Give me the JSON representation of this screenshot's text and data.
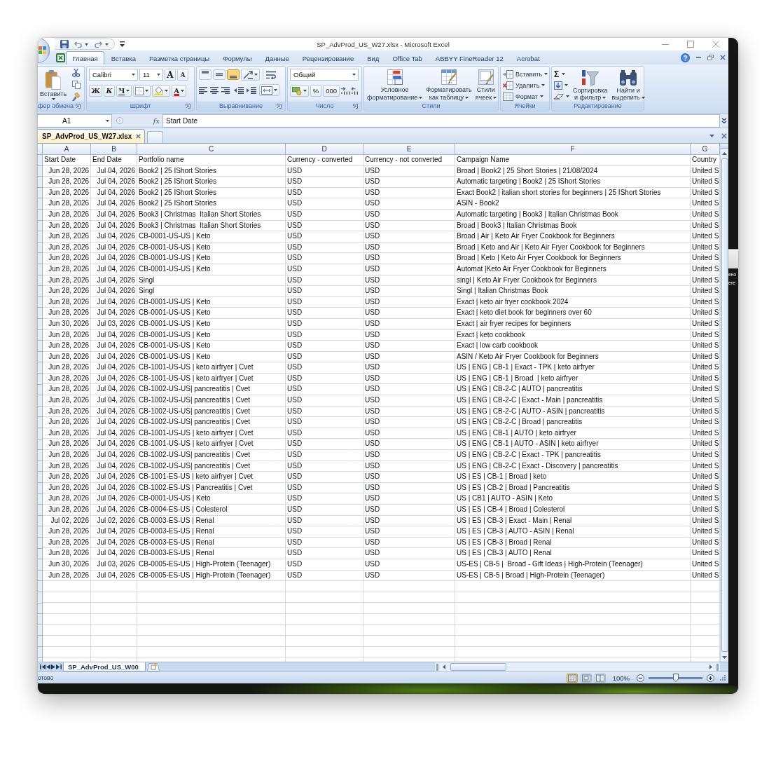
{
  "window": {
    "title": "SP_AdvProd_US_W27.xlsx - Microsoft Excel"
  },
  "ribbon_tabs": [
    {
      "label": "Главная",
      "selected": true
    },
    {
      "label": "Вставка",
      "selected": false
    },
    {
      "label": "Разметка страницы",
      "selected": false
    },
    {
      "label": "Формулы",
      "selected": false
    },
    {
      "label": "Данные",
      "selected": false
    },
    {
      "label": "Рецензирование",
      "selected": false
    },
    {
      "label": "Вид",
      "selected": false
    },
    {
      "label": "Office Tab",
      "selected": false
    },
    {
      "label": "ABBYY FineReader 12",
      "selected": false
    },
    {
      "label": "Acrobat",
      "selected": false
    }
  ],
  "ribbon_groups": [
    {
      "kind": "clipboard",
      "label": "фер обмена",
      "paste": "Вставить"
    },
    {
      "kind": "font",
      "label": "Шрифт",
      "font_name": "Calibri",
      "font_size": "11",
      "grow": "A",
      "shrink": "A",
      "styles": [
        "Ж",
        "К",
        "Ч"
      ],
      "font_color": "A"
    },
    {
      "kind": "alignment",
      "label": "Выравнивание",
      "vertical": [
        {
          "selected": false
        },
        {
          "selected": false
        },
        {
          "selected": true
        }
      ]
    },
    {
      "kind": "number",
      "label": "Число",
      "format": "Общий",
      "percent": "%",
      "thousands": "000"
    },
    {
      "kind": "styles",
      "label": "Стили",
      "buttons": [
        "Условное\nформатирование",
        "Форматировать\nкак таблицу",
        "Стили\nячеек"
      ]
    },
    {
      "kind": "cells",
      "label": "Ячейки",
      "buttons": [
        "Вставить",
        "Удалить",
        "Формат"
      ]
    },
    {
      "kind": "editing",
      "label": "Редактирование",
      "autosum": "Σ",
      "buttons": [
        "Сортировка\nи фильтр",
        "Найти и\nвыделить"
      ]
    }
  ],
  "formula_bar": {
    "name_box": "A1",
    "function_label": "fx",
    "value": "Start Date"
  },
  "document_tabs": [
    {
      "label": "SP_AdvProd_US_W27.xlsx",
      "selected": true
    }
  ],
  "sheet": {
    "columns": [
      "A",
      "B",
      "C",
      "D",
      "E",
      "F",
      "G"
    ],
    "header": [
      "Start Date",
      "End Date",
      "Portfolio name",
      "Currency - converted",
      "Currency - not converted",
      "Campaign Name",
      "Country"
    ],
    "rows": [
      [
        "Jun 28, 2026",
        "Jul 04, 2026",
        "Book2 | 25 IShort Stories",
        "USD",
        "USD",
        "Broad | Book2 | 25 Short Stories | 21/08/2024",
        "United S"
      ],
      [
        "Jun 28, 2026",
        "Jul 04, 2026",
        "Book2 | 25 IShort Stories",
        "USD",
        "USD",
        "Automatic targeting | Book2 | 25 IShort Stories",
        "United S"
      ],
      [
        "Jun 28, 2026",
        "Jul 04, 2026",
        "Book2 | 25 IShort Stories",
        "USD",
        "USD",
        "Exact Book2 | italian short stories for beginners | 25 IShort Stories",
        "United S"
      ],
      [
        "Jun 28, 2026",
        "Jul 04, 2026",
        "Book2 | 25 IShort Stories",
        "USD",
        "USD",
        "ASIN - Book2",
        "United S"
      ],
      [
        "Jun 28, 2026",
        "Jul 04, 2026",
        "Book3 | Christmas  Italian Short Stories",
        "USD",
        "USD",
        "Automatic targeting | Book3 | Italian Christmas Book",
        "United S"
      ],
      [
        "Jun 28, 2026",
        "Jul 04, 2026",
        "Book3 | Christmas  Italian Short Stories",
        "USD",
        "USD",
        "Broad | Book3 | Italian Christmas Book",
        "United S"
      ],
      [
        "Jun 28, 2026",
        "Jul 04, 2026",
        "CB-0001-US-US | Keto",
        "USD",
        "USD",
        "Broad | Air | Keto Air Fryer Cookbook for Beginners",
        "United S"
      ],
      [
        "Jun 28, 2026",
        "Jul 04, 2026",
        "CB-0001-US-US | Keto",
        "USD",
        "USD",
        "Broad | Keto and Air | Keto Air Fryer Cookbook for Beginners",
        "United S"
      ],
      [
        "Jun 28, 2026",
        "Jul 04, 2026",
        "CB-0001-US-US | Keto",
        "USD",
        "USD",
        "Broad | Keto | Keto Air Fryer Cookbook for Beginners",
        "United S"
      ],
      [
        "Jun 28, 2026",
        "Jul 04, 2026",
        "CB-0001-US-US | Keto",
        "USD",
        "USD",
        "Automat |Keto Air Fryer Cookbook for Beginners",
        "United S"
      ],
      [
        "Jun 28, 2026",
        "Jul 04, 2026",
        "Singl",
        "USD",
        "USD",
        "singl | Keto Air Fryer Cookbook for Beginners",
        "United S"
      ],
      [
        "Jun 28, 2026",
        "Jul 04, 2026",
        "Singl",
        "USD",
        "USD",
        "Singl | Italian Christmas Book",
        "United S"
      ],
      [
        "Jun 28, 2026",
        "Jul 04, 2026",
        "CB-0001-US-US | Keto",
        "USD",
        "USD",
        "Exact | keto air fryer cookbook 2024",
        "United S"
      ],
      [
        "Jun 28, 2026",
        "Jul 04, 2026",
        "CB-0001-US-US | Keto",
        "USD",
        "USD",
        "Exact | keto diet book for beginners over 60",
        "United S"
      ],
      [
        "Jun 30, 2026",
        "Jul 03, 2026",
        "CB-0001-US-US | Keto",
        "USD",
        "USD",
        "Exact | air fryer recipes for beginners",
        "United S"
      ],
      [
        "Jun 28, 2026",
        "Jul 04, 2026",
        "CB-0001-US-US | Keto",
        "USD",
        "USD",
        "Exact | keto cookbook",
        "United S"
      ],
      [
        "Jun 28, 2026",
        "Jul 04, 2026",
        "CB-0001-US-US | Keto",
        "USD",
        "USD",
        "Exact | low carb cookbook",
        "United S"
      ],
      [
        "Jun 28, 2026",
        "Jul 04, 2026",
        "CB-0001-US-US | Keto",
        "USD",
        "USD",
        "ASIN / Keto Air Fryer Cookbook for Beginners",
        "United S"
      ],
      [
        "Jun 28, 2026",
        "Jul 04, 2026",
        "CB-1001-US-US | keto airfryer | Cvet",
        "USD",
        "USD",
        "US | ENG | CB-1 | Exact - TPK | keto airfryer",
        "United S"
      ],
      [
        "Jun 28, 2026",
        "Jul 04, 2026",
        "CB-1001-US-US | keto airfryer | Cvet",
        "USD",
        "USD",
        "US | ENG | CB-1 | Broad  | keto airfryer",
        "United S"
      ],
      [
        "Jun 28, 2026",
        "Jul 04, 2026",
        "CB-1002-US-US| pancreatitis | Cvet",
        "USD",
        "USD",
        "US | ENG | CB-2-C | AUTO | pancreatitis",
        "United S"
      ],
      [
        "Jun 28, 2026",
        "Jul 04, 2026",
        "CB-1002-US-US| pancreatitis | Cvet",
        "USD",
        "USD",
        "US | ENG | CB-2-C | Exact - Main | pancreatitis",
        "United S"
      ],
      [
        "Jun 28, 2026",
        "Jul 04, 2026",
        "CB-1002-US-US| pancreatitis | Cvet",
        "USD",
        "USD",
        "US | ENG | CB-2-C | AUTO - ASIN | pancreatitis",
        "United S"
      ],
      [
        "Jun 28, 2026",
        "Jul 04, 2026",
        "CB-1002-US-US| pancreatitis | Cvet",
        "USD",
        "USD",
        "US | ENG | CB-2-C | Broad | pancreatitis",
        "United S"
      ],
      [
        "Jun 28, 2026",
        "Jul 04, 2026",
        "CB-1001-US-US | keto airfryer | Cvet",
        "USD",
        "USD",
        "US | ENG | CB-1 | AUTO | keto airfryer",
        "United S"
      ],
      [
        "Jun 28, 2026",
        "Jul 04, 2026",
        "CB-1001-US-US | keto airfryer | Cvet",
        "USD",
        "USD",
        "US | ENG | CB-1 | AUTO - ASIN | keto airfryer",
        "United S"
      ],
      [
        "Jun 28, 2026",
        "Jul 04, 2026",
        "CB-1002-US-US| pancreatitis | Cvet",
        "USD",
        "USD",
        "US | ENG | CB-2-C | Exact - TPK | pancreatitis",
        "United S"
      ],
      [
        "Jun 28, 2026",
        "Jul 04, 2026",
        "CB-1002-US-US| pancreatitis | Cvet",
        "USD",
        "USD",
        "US | ENG | CB-2-C | Exact - Discovery | pancreatitis",
        "United S"
      ],
      [
        "Jun 28, 2026",
        "Jul 04, 2026",
        "CB-1001-ES-US | keto airfryer | Cvet",
        "USD",
        "USD",
        "US | ES | CB-1 | Broad | keto",
        "United S"
      ],
      [
        "Jun 28, 2026",
        "Jul 04, 2026",
        "CB-1002-ES-US | Pancreatitis | Cvet",
        "USD",
        "USD",
        "US | ES | CB-2 | Broad | Pancreatitis",
        "United S"
      ],
      [
        "Jun 28, 2026",
        "Jul 04, 2026",
        "CB-0001-US-US | Keto",
        "USD",
        "USD",
        "US | CB1 | AUTO - ASIN | Keto",
        "United S"
      ],
      [
        "Jun 28, 2026",
        "Jul 04, 2026",
        "CB-0004-ES-US | Colesterol",
        "USD",
        "USD",
        "US | ES | CB-4 | Broad | Colesterol",
        "United S"
      ],
      [
        "Jul 02, 2026",
        "Jul 02, 2026",
        "CB-0003-ES-US | Renal",
        "USD",
        "USD",
        "US | ES | CB-3 | Exact - Main | Renal",
        "United S"
      ],
      [
        "Jun 28, 2026",
        "Jul 04, 2026",
        "CB-0003-ES-US | Renal",
        "USD",
        "USD",
        "US | ES | CB-3 | AUTO - ASIN | Renal",
        "United S"
      ],
      [
        "Jun 28, 2026",
        "Jul 04, 2026",
        "CB-0003-ES-US | Renal",
        "USD",
        "USD",
        "US | ES | CB-3 | Broad | Renal",
        "United S"
      ],
      [
        "Jun 28, 2026",
        "Jul 04, 2026",
        "CB-0003-ES-US | Renal",
        "USD",
        "USD",
        "US | ES | CB-3 | AUTO | Renal",
        "United S"
      ],
      [
        "Jun 30, 2026",
        "Jul 03, 2026",
        "CB-0005-ES-US | High-Protein (Teenager)",
        "USD",
        "USD",
        "US-ES | CB-5 |  Broad - Gift Ideas | High-Protein (Teenager)",
        "United S"
      ],
      [
        "Jun 28, 2026",
        "Jul 04, 2026",
        "CB-0005-ES-US | High-Protein (Teenager)",
        "USD",
        "USD",
        "US-ES | CB-5 | Broad | High-Protein (Teenager)",
        "United S"
      ]
    ]
  },
  "sheet_tabs": [
    {
      "label": "SP_AdvProd_US_W00",
      "selected": true
    }
  ],
  "status_bar": {
    "status": "отово",
    "views": [
      {
        "selected": true
      },
      {
        "selected": false
      },
      {
        "selected": false
      }
    ],
    "zoom": "100%",
    "zoom_slider": {
      "level": 0.5
    }
  },
  "desktop": {
    "texts": [
      "ено",
      "ете"
    ]
  }
}
